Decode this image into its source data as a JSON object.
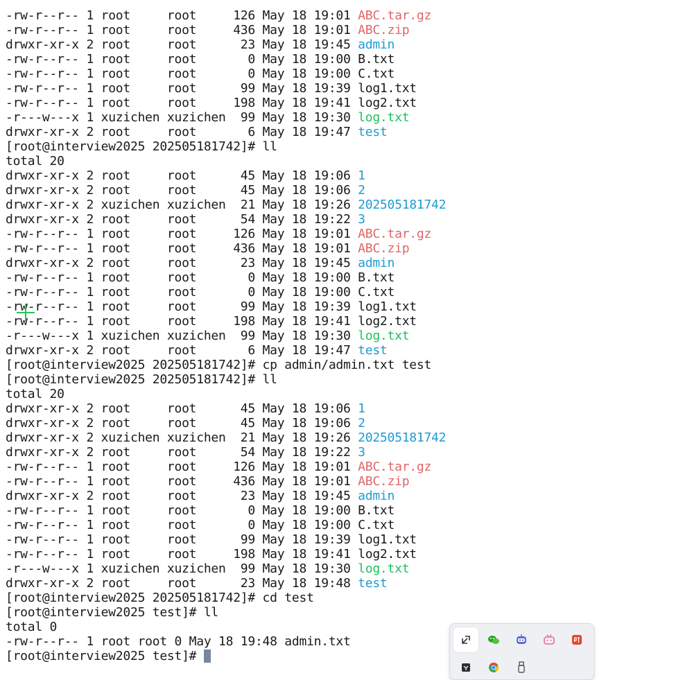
{
  "terminal": {
    "lines": [
      {
        "prefix": "-rw-r--r-- 1 root     root     126 May 18 19:01 ",
        "name": "ABC.tar.gz",
        "kind": "archive"
      },
      {
        "prefix": "-rw-r--r-- 1 root     root     436 May 18 19:01 ",
        "name": "ABC.zip",
        "kind": "archive"
      },
      {
        "prefix": "drwxr-xr-x 2 root     root      23 May 18 19:45 ",
        "name": "admin",
        "kind": "dir"
      },
      {
        "prefix": "-rw-r--r-- 1 root     root       0 May 18 19:00 ",
        "name": "B.txt",
        "kind": "plain"
      },
      {
        "prefix": "-rw-r--r-- 1 root     root       0 May 18 19:00 ",
        "name": "C.txt",
        "kind": "plain"
      },
      {
        "prefix": "-rw-r--r-- 1 root     root      99 May 18 19:39 ",
        "name": "log1.txt",
        "kind": "plain"
      },
      {
        "prefix": "-rw-r--r-- 1 root     root     198 May 18 19:41 ",
        "name": "log2.txt",
        "kind": "plain"
      },
      {
        "prefix": "-r---w---x 1 xuzichen xuzichen  99 May 18 19:30 ",
        "name": "log.txt",
        "kind": "exec"
      },
      {
        "prefix": "drwxr-xr-x 2 root     root       6 May 18 19:47 ",
        "name": "test",
        "kind": "dir"
      },
      {
        "prefix": "[root@interview2025 202505181742]# ll",
        "name": "",
        "kind": "plain"
      },
      {
        "prefix": "total 20",
        "name": "",
        "kind": "plain"
      },
      {
        "prefix": "drwxr-xr-x 2 root     root      45 May 18 19:06 ",
        "name": "1",
        "kind": "dir"
      },
      {
        "prefix": "drwxr-xr-x 2 root     root      45 May 18 19:06 ",
        "name": "2",
        "kind": "dir"
      },
      {
        "prefix": "drwxr-xr-x 2 xuzichen xuzichen  21 May 18 19:26 ",
        "name": "202505181742",
        "kind": "dir"
      },
      {
        "prefix": "drwxr-xr-x 2 root     root      54 May 18 19:22 ",
        "name": "3",
        "kind": "dir"
      },
      {
        "prefix": "-rw-r--r-- 1 root     root     126 May 18 19:01 ",
        "name": "ABC.tar.gz",
        "kind": "archive"
      },
      {
        "prefix": "-rw-r--r-- 1 root     root     436 May 18 19:01 ",
        "name": "ABC.zip",
        "kind": "archive"
      },
      {
        "prefix": "drwxr-xr-x 2 root     root      23 May 18 19:45 ",
        "name": "admin",
        "kind": "dir"
      },
      {
        "prefix": "-rw-r--r-- 1 root     root       0 May 18 19:00 ",
        "name": "B.txt",
        "kind": "plain"
      },
      {
        "prefix": "-rw-r--r-- 1 root     root       0 May 18 19:00 ",
        "name": "C.txt",
        "kind": "plain"
      },
      {
        "prefix": "-rw-r--r-- 1 root     root      99 May 18 19:39 ",
        "name": "log1.txt",
        "kind": "plain"
      },
      {
        "prefix": "-rw-r--r-- 1 root     root     198 May 18 19:41 ",
        "name": "log2.txt",
        "kind": "plain"
      },
      {
        "prefix": "-r---w---x 1 xuzichen xuzichen  99 May 18 19:30 ",
        "name": "log.txt",
        "kind": "exec"
      },
      {
        "prefix": "drwxr-xr-x 2 root     root       6 May 18 19:47 ",
        "name": "test",
        "kind": "dir"
      },
      {
        "prefix": "[root@interview2025 202505181742]# cp admin/admin.txt test",
        "name": "",
        "kind": "plain"
      },
      {
        "prefix": "[root@interview2025 202505181742]# ll",
        "name": "",
        "kind": "plain"
      },
      {
        "prefix": "total 20",
        "name": "",
        "kind": "plain"
      },
      {
        "prefix": "drwxr-xr-x 2 root     root      45 May 18 19:06 ",
        "name": "1",
        "kind": "dir"
      },
      {
        "prefix": "drwxr-xr-x 2 root     root      45 May 18 19:06 ",
        "name": "2",
        "kind": "dir"
      },
      {
        "prefix": "drwxr-xr-x 2 xuzichen xuzichen  21 May 18 19:26 ",
        "name": "202505181742",
        "kind": "dir"
      },
      {
        "prefix": "drwxr-xr-x 2 root     root      54 May 18 19:22 ",
        "name": "3",
        "kind": "dir"
      },
      {
        "prefix": "-rw-r--r-- 1 root     root     126 May 18 19:01 ",
        "name": "ABC.tar.gz",
        "kind": "archive"
      },
      {
        "prefix": "-rw-r--r-- 1 root     root     436 May 18 19:01 ",
        "name": "ABC.zip",
        "kind": "archive"
      },
      {
        "prefix": "drwxr-xr-x 2 root     root      23 May 18 19:45 ",
        "name": "admin",
        "kind": "dir"
      },
      {
        "prefix": "-rw-r--r-- 1 root     root       0 May 18 19:00 ",
        "name": "B.txt",
        "kind": "plain"
      },
      {
        "prefix": "-rw-r--r-- 1 root     root       0 May 18 19:00 ",
        "name": "C.txt",
        "kind": "plain"
      },
      {
        "prefix": "-rw-r--r-- 1 root     root      99 May 18 19:39 ",
        "name": "log1.txt",
        "kind": "plain"
      },
      {
        "prefix": "-rw-r--r-- 1 root     root     198 May 18 19:41 ",
        "name": "log2.txt",
        "kind": "plain"
      },
      {
        "prefix": "-r---w---x 1 xuzichen xuzichen  99 May 18 19:30 ",
        "name": "log.txt",
        "kind": "exec"
      },
      {
        "prefix": "drwxr-xr-x 2 root     root      23 May 18 19:48 ",
        "name": "test",
        "kind": "dir"
      },
      {
        "prefix": "[root@interview2025 202505181742]# cd test",
        "name": "",
        "kind": "plain"
      },
      {
        "prefix": "[root@interview2025 test]# ll",
        "name": "",
        "kind": "plain"
      },
      {
        "prefix": "total 0",
        "name": "",
        "kind": "plain"
      },
      {
        "prefix": "-rw-r--r-- 1 root root 0 May 18 19:48 admin.txt",
        "name": "",
        "kind": "plain"
      }
    ],
    "prompt": "[root@interview2025 test]# "
  },
  "colors": {
    "archive": "#e06666",
    "directory": "#1f9bd1",
    "executable": "#1fbf5c",
    "crosshair": "#22c55e"
  },
  "tray": {
    "icons": [
      {
        "name": "resize-icon",
        "color": "#333333"
      },
      {
        "name": "wechat-icon",
        "color": "#1aad19"
      },
      {
        "name": "robot-assistant-icon",
        "color": "#5b6bd6"
      },
      {
        "name": "bilibili-tv-icon",
        "color": "#f2779b"
      },
      {
        "name": "ting-listen-icon",
        "color": "#e8452e"
      },
      {
        "name": "cursor-app-icon",
        "color": "#2d2d2d"
      },
      {
        "name": "chrome-icon",
        "color": "#34a853"
      },
      {
        "name": "usb-drive-icon",
        "color": "#555555"
      }
    ]
  }
}
